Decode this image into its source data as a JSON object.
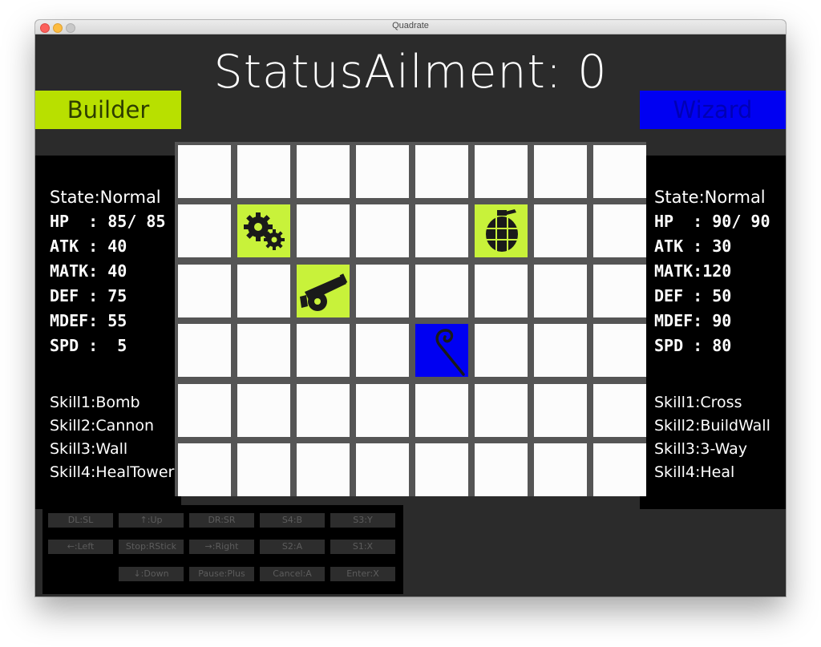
{
  "window": {
    "title": "Quadrate"
  },
  "header": {
    "title": "StatusAilment: 0"
  },
  "players": {
    "left": {
      "name": "Builder",
      "state": "State:Normal",
      "stats": [
        "HP  : 85/ 85",
        "ATK : 40",
        "MATK: 40",
        "DEF : 75",
        "MDEF: 55",
        "SPD :  5"
      ],
      "skills": [
        "Skill1:Bomb",
        "Skill2:Cannon",
        "Skill3:Wall",
        "Skill4:HealTower"
      ],
      "color": "#b8e000"
    },
    "right": {
      "name": "Wizard",
      "state": "State:Normal",
      "stats": [
        "HP  : 90/ 90",
        "ATK : 30",
        "MATK:120",
        "DEF : 50",
        "MDEF: 90",
        "SPD : 80"
      ],
      "skills": [
        "Skill1:Cross",
        "Skill2:BuildWall",
        "Skill3:3-Way",
        "Skill4:Heal"
      ],
      "color": "#0000f2"
    }
  },
  "board": {
    "cols": 8,
    "rows": 6,
    "pieces": [
      {
        "row": 1,
        "col": 1,
        "icon": "gears-icon",
        "owner": "builder",
        "color": "#c8f23a"
      },
      {
        "row": 1,
        "col": 5,
        "icon": "grenade-icon",
        "owner": "builder",
        "color": "#c8f23a"
      },
      {
        "row": 2,
        "col": 2,
        "icon": "cannon-icon",
        "owner": "builder",
        "color": "#c8f23a"
      },
      {
        "row": 3,
        "col": 4,
        "icon": "wizard-staff-icon",
        "owner": "wizard",
        "color": "#0000f2"
      }
    ]
  },
  "controls": [
    [
      "DL:SL",
      "↑:Up",
      "DR:SR",
      "S4:B",
      "S3:Y"
    ],
    [
      "←:Left",
      "Stop:RStick",
      "→:Right",
      "S2:A",
      "S1:X"
    ],
    [
      "",
      "↓:Down",
      "Pause:Plus",
      "Cancel:A",
      "Enter:X"
    ]
  ]
}
